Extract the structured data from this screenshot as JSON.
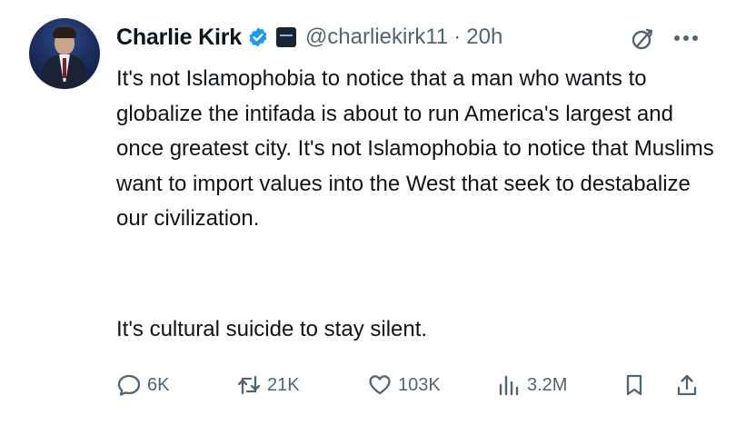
{
  "author": {
    "name": "Charlie Kirk",
    "handle": "@charliekirk11",
    "separator": "·",
    "time": "20h"
  },
  "tweet": {
    "paragraphs": [
      "It's not Islamophobia to notice that a man who wants to globalize the intifada is about to run America's largest and once greatest city. It's not Islamophobia to notice that Muslims want to import values into the West that seek to destabalize our civilization.",
      "It's cultural suicide to stay silent."
    ]
  },
  "actions": {
    "replies": "6K",
    "reposts": "21K",
    "likes": "103K",
    "views": "3.2M"
  },
  "icons": {
    "verified": "verified-badge-icon",
    "affiliation": "affiliation-badge-icon",
    "grok": "grok-icon",
    "more": "more-dots-icon",
    "reply": "reply-icon",
    "repost": "repost-icon",
    "like": "heart-icon",
    "views": "views-bar-chart-icon",
    "bookmark": "bookmark-icon",
    "share": "share-icon"
  },
  "colors": {
    "text": "#0f1419",
    "secondary": "#536471",
    "verified_blue": "#1d9bf0"
  }
}
